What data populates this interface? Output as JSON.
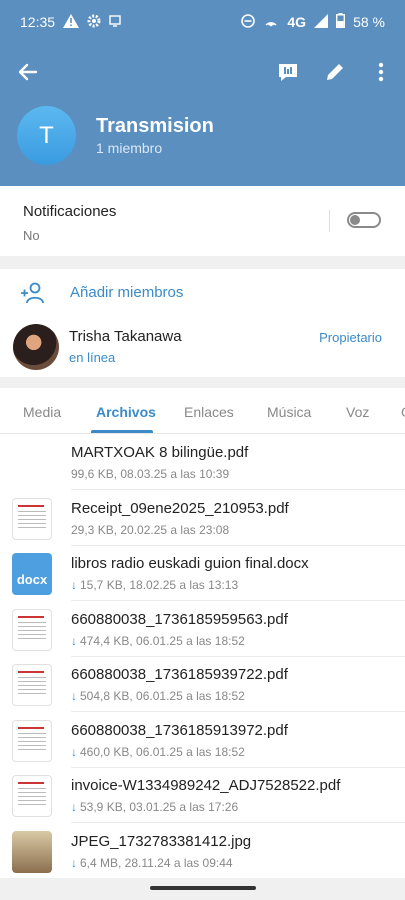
{
  "status": {
    "time": "12:35",
    "network": "4G",
    "battery": "58 %"
  },
  "header": {
    "avatar_letter": "T",
    "title": "Transmision",
    "subtitle": "1 miembro"
  },
  "notifications": {
    "label": "Notificaciones",
    "value": "No",
    "enabled": false
  },
  "members": {
    "add_label": "Añadir miembros",
    "items": [
      {
        "name": "Trisha Takanawa",
        "status": "en línea",
        "role": "Propietario"
      }
    ]
  },
  "tabs": [
    "Media",
    "Archivos",
    "Enlaces",
    "Música",
    "Voz"
  ],
  "active_tab": "Archivos",
  "files": [
    {
      "name": "MARTXOAK 8 bilingüe.pdf",
      "meta": "99,6 KB, 08.03.25 a las 10:39",
      "thumb": "none",
      "downloaded": true
    },
    {
      "name": "Receipt_09ene2025_210953.pdf",
      "meta": "29,3 KB, 20.02.25 a las 23:08",
      "thumb": "doc",
      "downloaded": true
    },
    {
      "name": "libros radio euskadi guion final.docx",
      "meta": "15,7 KB, 18.02.25 a las 13:13",
      "thumb": "docx",
      "thumb_label": "docx",
      "downloaded": false
    },
    {
      "name": "660880038_1736185959563.pdf",
      "meta": "474,4 KB, 06.01.25 a las 18:52",
      "thumb": "doc",
      "downloaded": false
    },
    {
      "name": "660880038_1736185939722.pdf",
      "meta": "504,8 KB, 06.01.25 a las 18:52",
      "thumb": "doc",
      "downloaded": false
    },
    {
      "name": "660880038_1736185913972.pdf",
      "meta": "460,0 KB, 06.01.25 a las 18:52",
      "thumb": "doc",
      "downloaded": false
    },
    {
      "name": "invoice-W1334989242_ADJ7528522.pdf",
      "meta": "53,9 KB, 03.01.25 a las 17:26",
      "thumb": "doc",
      "downloaded": false
    },
    {
      "name": "JPEG_1732783381412.jpg",
      "meta": "6,4 MB, 28.11.24 a las 09:44",
      "thumb": "photo",
      "downloaded": false
    }
  ],
  "colors": {
    "header": "#5a8fbf",
    "accent": "#3a8bc8"
  }
}
